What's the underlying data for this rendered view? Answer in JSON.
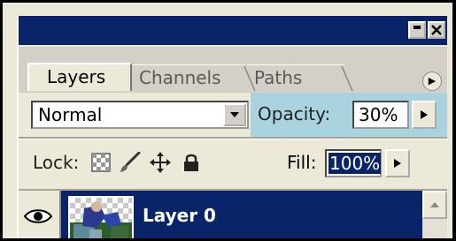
{
  "tabs": [
    {
      "label": "Layers",
      "active": true
    },
    {
      "label": "Channels",
      "active": false
    },
    {
      "label": "Paths",
      "active": false
    }
  ],
  "blend_mode": {
    "value": "Normal"
  },
  "opacity": {
    "label": "Opacity:",
    "value": "30%"
  },
  "lock": {
    "label": "Lock:",
    "icons": [
      "lock-transparent-pixels-icon",
      "lock-image-pixels-icon",
      "lock-position-icon",
      "lock-all-icon"
    ]
  },
  "fill": {
    "label": "Fill:",
    "value": "100%"
  },
  "layers": [
    {
      "name": "Layer 0",
      "visible": true,
      "selected": true
    }
  ],
  "colors": {
    "title_bar": "#0a246a",
    "selection": "#0a246a",
    "panel": "#ece9d8",
    "opacity_highlight": "#a9d3df"
  }
}
